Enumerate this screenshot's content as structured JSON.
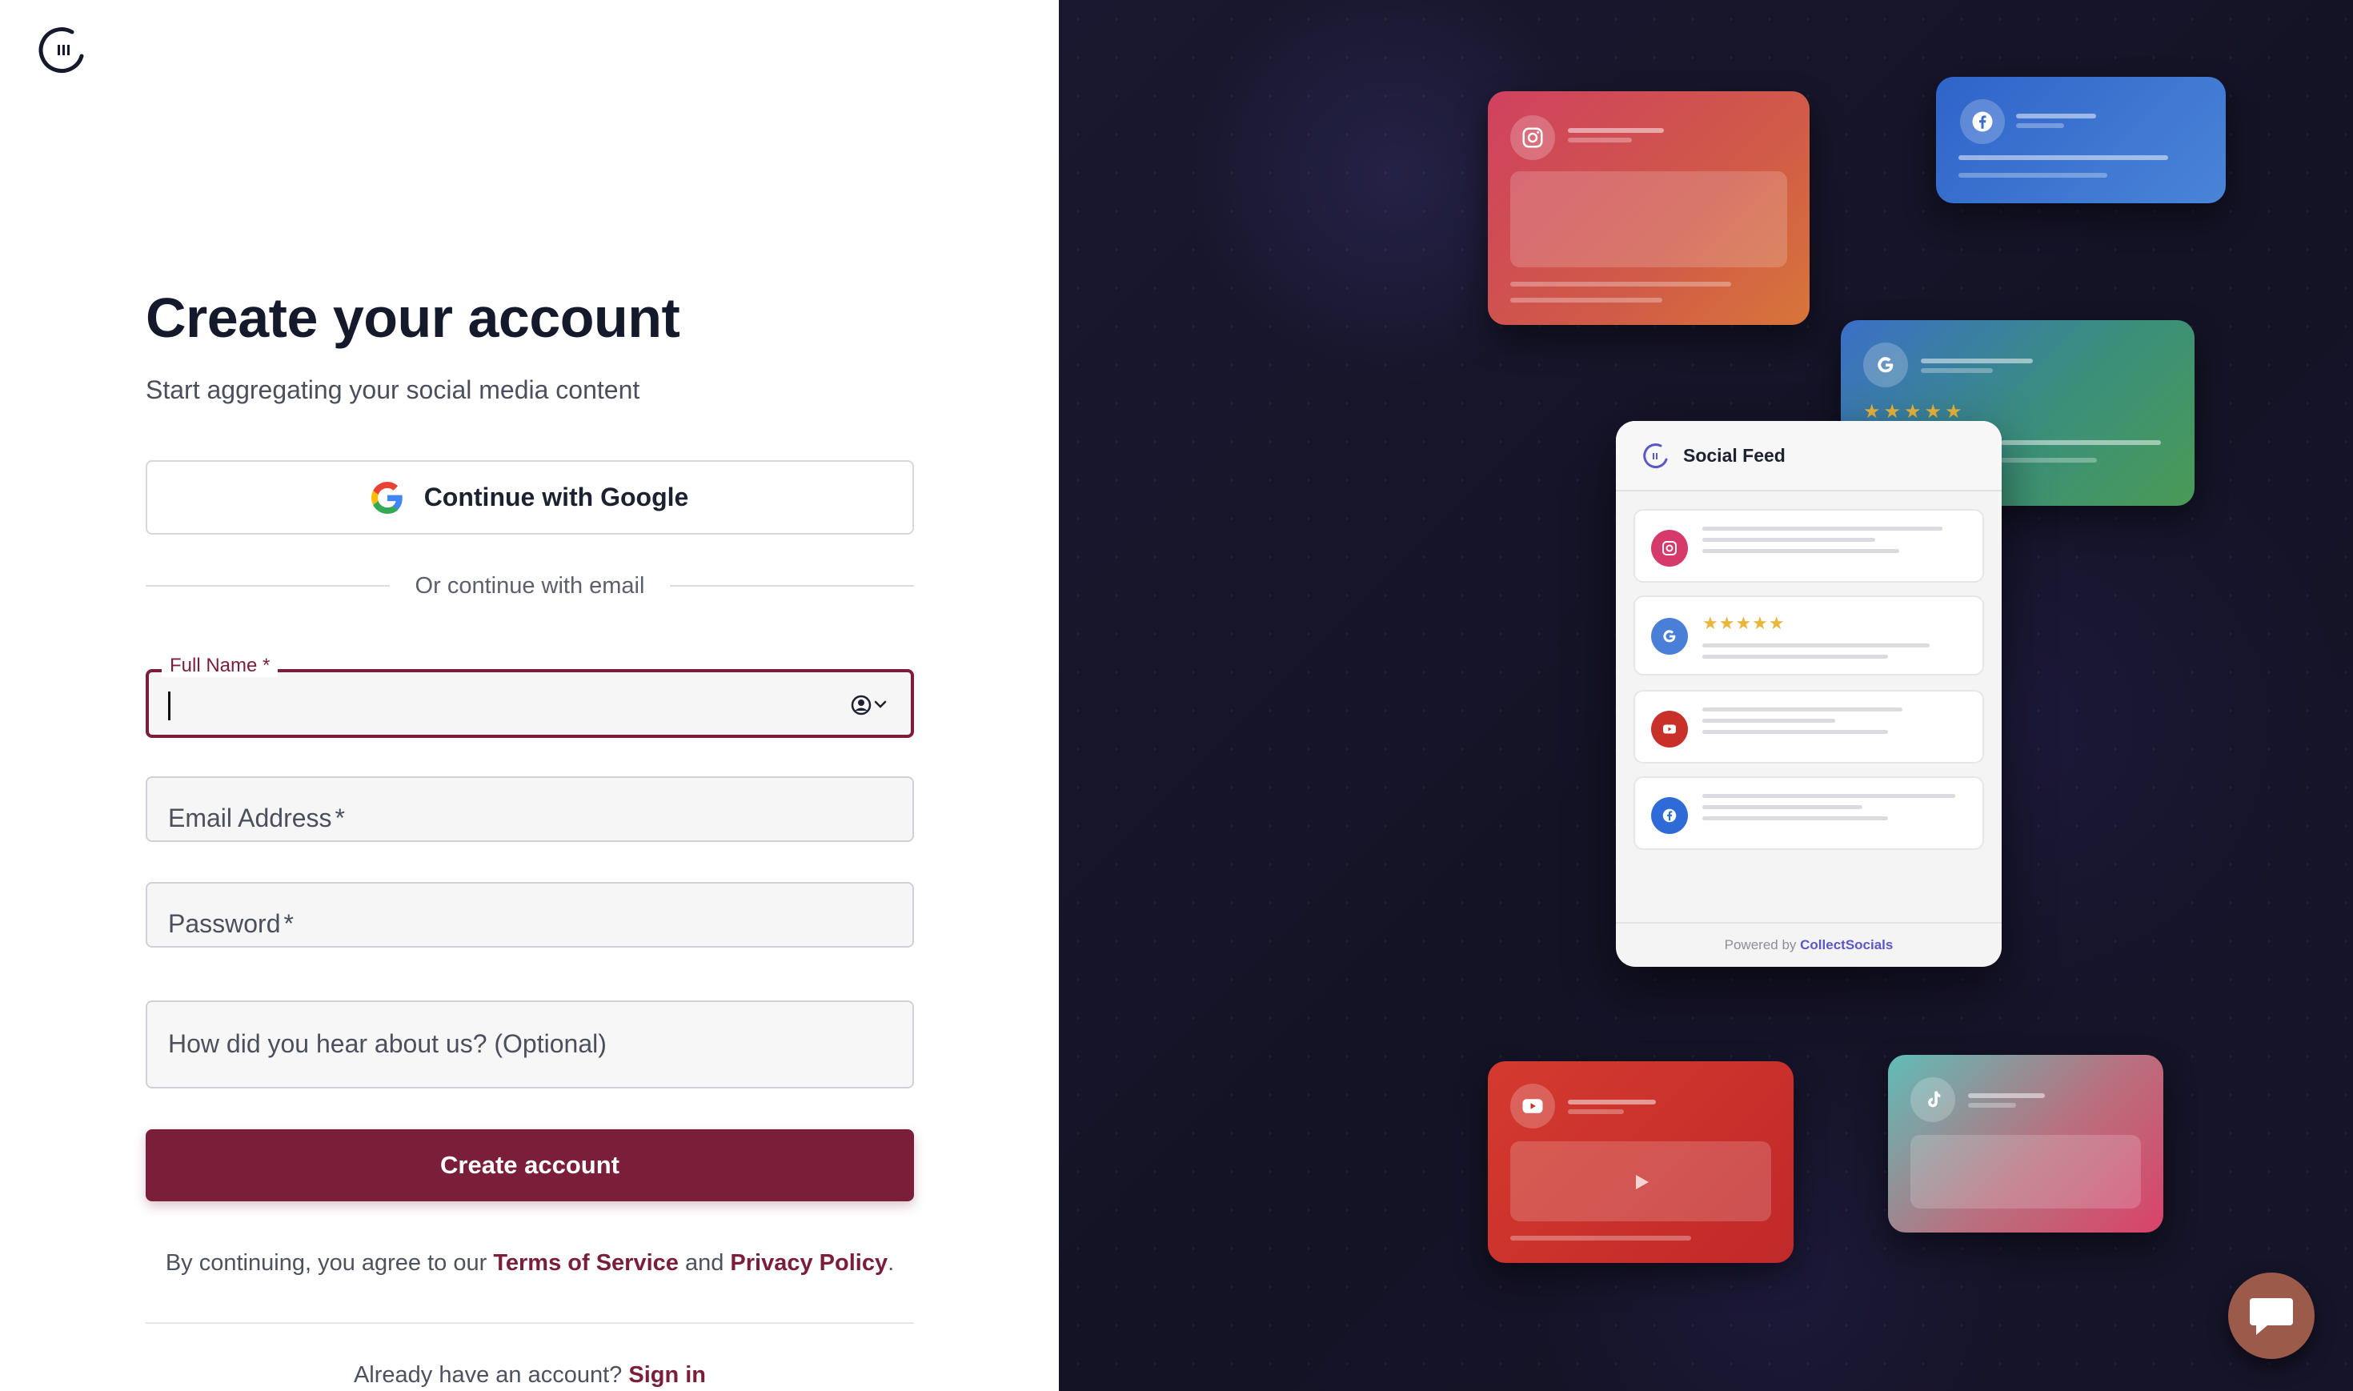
{
  "form": {
    "title": "Create your account",
    "subtitle": "Start aggregating your social media content",
    "google_label": "Continue with Google",
    "divider_text": "Or continue with email",
    "full_name": {
      "label": "Full Name",
      "required_mark": "*",
      "value": ""
    },
    "email": {
      "placeholder": "Email Address",
      "required_mark": "*"
    },
    "password": {
      "placeholder": "Password",
      "required_mark": "*"
    },
    "referral": {
      "placeholder": "How did you hear about us? (Optional)"
    },
    "submit_label": "Create account",
    "terms_prefix": "By continuing, you agree to our ",
    "terms_link": "Terms of Service",
    "terms_and": " and ",
    "privacy_link": "Privacy Policy",
    "terms_suffix": ".",
    "signin_prefix": "Already have an account? ",
    "signin_link": "Sign in"
  },
  "preview": {
    "feed_title": "Social Feed",
    "google_stars": "★★★★★",
    "feed_stars": "★★★★★",
    "powered_by": "Powered by ",
    "brand": "CollectSocials",
    "items": [
      "instagram",
      "google",
      "youtube",
      "facebook"
    ]
  },
  "colors": {
    "accent": "#7b1e3a",
    "right_bg": "#161429",
    "brand_link": "#5a58c9",
    "star": "#e9b53a"
  },
  "icons": [
    "app-logo-icon",
    "google-icon",
    "contact-autofill-icon",
    "instagram-icon",
    "facebook-icon",
    "youtube-icon",
    "tiktok-icon",
    "chat-icon"
  ]
}
